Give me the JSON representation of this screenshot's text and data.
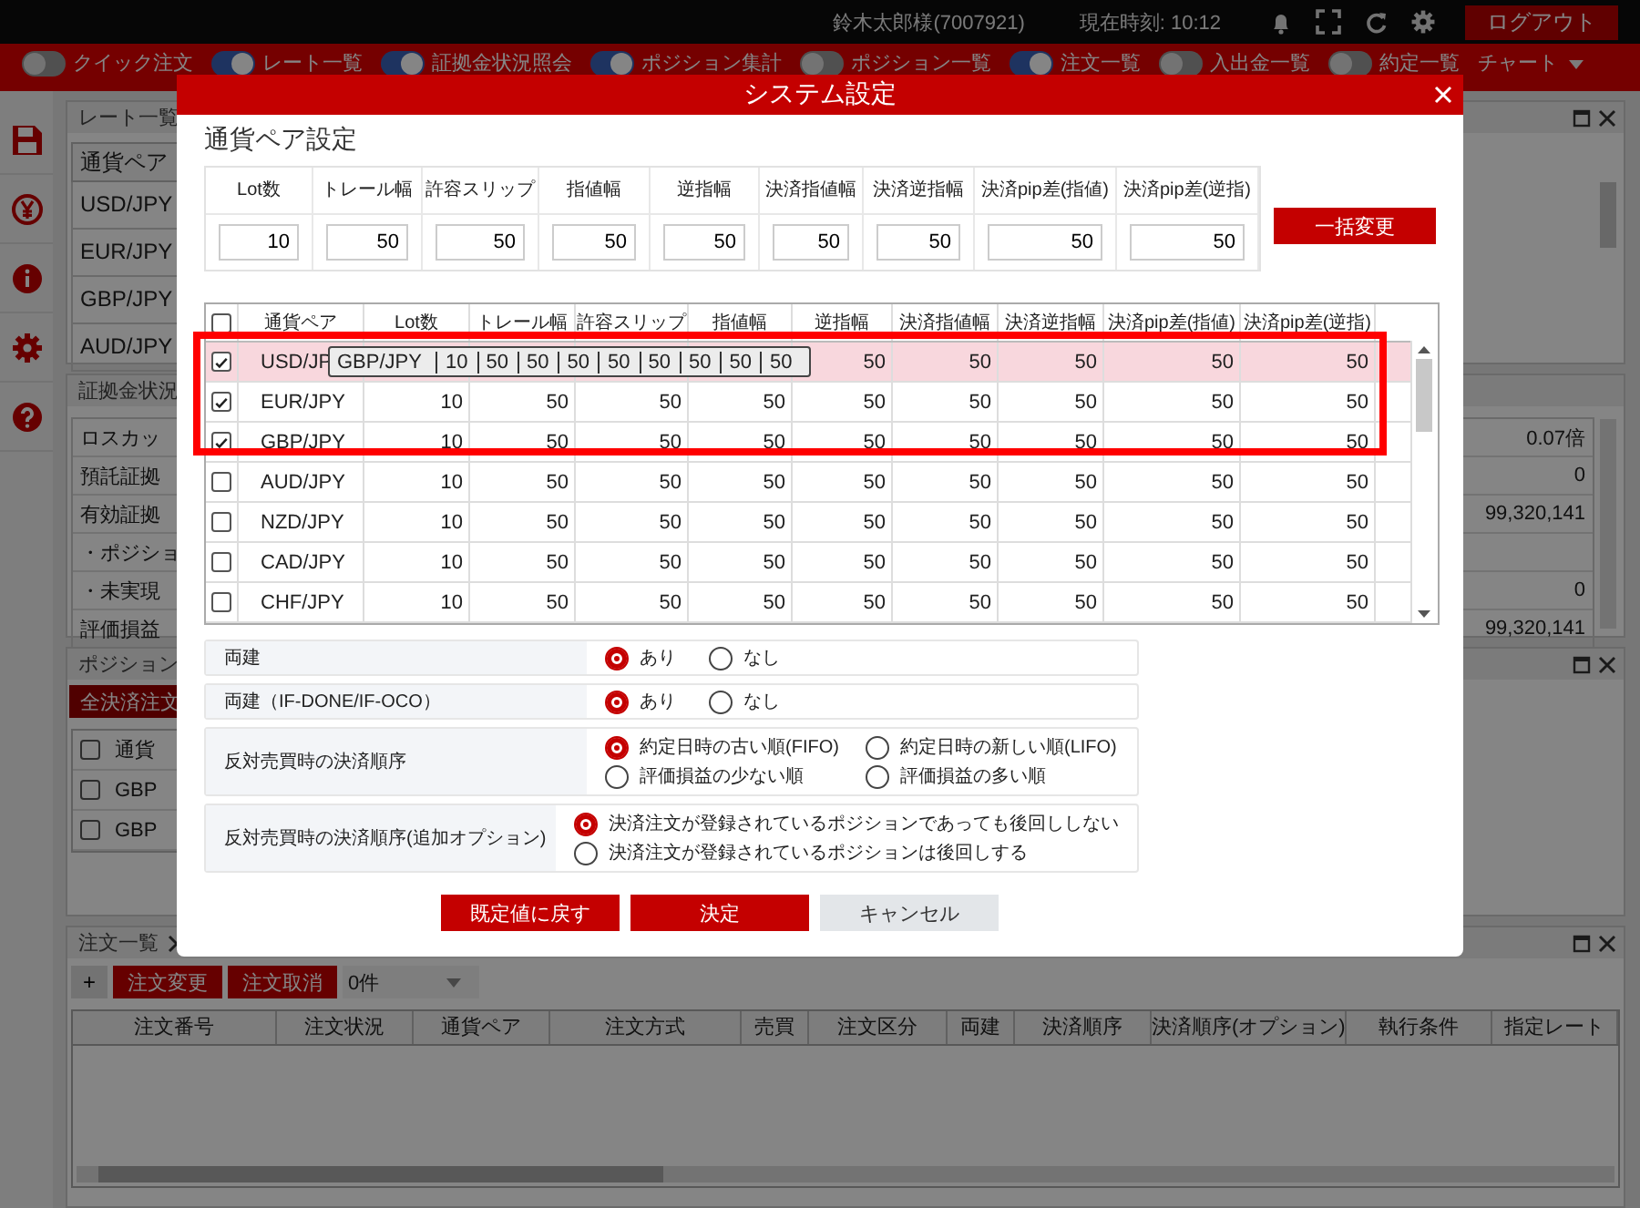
{
  "header": {
    "user": "鈴木太郎様(7007921)",
    "clock": "現在時刻: 10:12",
    "logout": "ログアウト"
  },
  "nav": [
    {
      "kind": "toggle",
      "label": "クイック注文",
      "on": false
    },
    {
      "kind": "toggle",
      "label": "レート一覧",
      "on": true
    },
    {
      "kind": "toggle",
      "label": "証拠金状況照会",
      "on": true
    },
    {
      "kind": "toggle",
      "label": "ポジション集計",
      "on": true
    },
    {
      "kind": "toggle",
      "label": "ポジション一覧",
      "on": false
    },
    {
      "kind": "toggle",
      "label": "注文一覧",
      "on": true
    },
    {
      "kind": "toggle",
      "label": "入出金一覧",
      "on": false
    },
    {
      "kind": "toggle",
      "label": "約定一覧",
      "on": false
    },
    {
      "kind": "menu",
      "label": "チャート"
    }
  ],
  "rate_panel": {
    "title": "レート一覧",
    "column": "通貨ペア",
    "rows": [
      "USD/JPY",
      "EUR/JPY",
      "GBP/JPY",
      "AUD/JPY"
    ]
  },
  "margin_panel": {
    "title": "証拠金状況",
    "rows": [
      {
        "label": "ロスカッ",
        "value": "0.07倍"
      },
      {
        "label": "預託証拠",
        "value": "0"
      },
      {
        "label": "有効証拠",
        "value": "99,320,141"
      },
      {
        "label": "・ポジショ"
      },
      {
        "label": "・未実現",
        "value": "0"
      },
      {
        "label": "評価損益",
        "value": "99,320,141"
      }
    ]
  },
  "position_panel": {
    "title": "ポジション",
    "button": "全決済注文",
    "header_checked": false,
    "column": "通貨",
    "rows": [
      {
        "pair": "GBP",
        "checked": false
      },
      {
        "pair": "GBP",
        "checked": false
      }
    ]
  },
  "order_panel": {
    "title": "注文一覧",
    "add": "+",
    "buttons": [
      "注文変更",
      "注文取消"
    ],
    "count": "0件",
    "columns": [
      "注文番号",
      "注文状況",
      "通貨ペア",
      "注文方式",
      "売買",
      "注文区分",
      "両建",
      "決済順序",
      "決済順序(オプション)",
      "執行条件",
      "指定レート"
    ]
  },
  "modal": {
    "title": "システム設定",
    "section": "通貨ペア設定",
    "batch": {
      "columns": [
        "Lot数",
        "トレール幅",
        "許容スリップ",
        "指値幅",
        "逆指幅",
        "決済指値幅",
        "決済逆指幅",
        "決済pip差(指値)",
        "決済pip差(逆指)"
      ],
      "values": [
        "10",
        "50",
        "50",
        "50",
        "50",
        "50",
        "50",
        "50",
        "50"
      ],
      "button": "一括変更"
    },
    "pairs": {
      "header_checked": false,
      "columns": [
        "通貨ペア",
        "Lot数",
        "トレール幅",
        "許容スリップ",
        "指値幅",
        "逆指幅",
        "決済指値幅",
        "決済逆指幅",
        "決済pip差(指値)",
        "決済pip差(逆指)"
      ],
      "rows": [
        {
          "checked": true,
          "selected": true,
          "cells": [
            "USD/JP",
            "",
            "",
            "",
            "",
            "50",
            "50",
            "50",
            "50",
            "50"
          ]
        },
        {
          "checked": true,
          "selected": false,
          "cells": [
            "EUR/JPY",
            "10",
            "50",
            "50",
            "50",
            "50",
            "50",
            "50",
            "50",
            "50"
          ]
        },
        {
          "checked": true,
          "selected": false,
          "cells": [
            "GBP/JPY",
            "10",
            "50",
            "50",
            "50",
            "50",
            "50",
            "50",
            "50",
            "50"
          ]
        },
        {
          "checked": false,
          "selected": false,
          "cells": [
            "AUD/JPY",
            "10",
            "50",
            "50",
            "50",
            "50",
            "50",
            "50",
            "50",
            "50"
          ]
        },
        {
          "checked": false,
          "selected": false,
          "cells": [
            "NZD/JPY",
            "10",
            "50",
            "50",
            "50",
            "50",
            "50",
            "50",
            "50",
            "50"
          ]
        },
        {
          "checked": false,
          "selected": false,
          "cells": [
            "CAD/JPY",
            "10",
            "50",
            "50",
            "50",
            "50",
            "50",
            "50",
            "50",
            "50"
          ]
        },
        {
          "checked": false,
          "selected": false,
          "cells": [
            "CHF/JPY",
            "10",
            "50",
            "50",
            "50",
            "50",
            "50",
            "50",
            "50",
            "50"
          ]
        }
      ]
    },
    "drag_preview": {
      "pair": "GBP/JPY",
      "values": [
        "10",
        "50",
        "50",
        "50",
        "50",
        "50",
        "50",
        "50",
        "50"
      ]
    },
    "annotation": {
      "kind": "frame"
    },
    "options": [
      {
        "label": "両建",
        "kind": "inline",
        "choices": [
          {
            "label": "あり",
            "selected": true
          },
          {
            "label": "なし",
            "selected": false
          }
        ]
      },
      {
        "label": "両建（IF-DONE/IF-OCO）",
        "kind": "inline",
        "choices": [
          {
            "label": "あり",
            "selected": true
          },
          {
            "label": "なし",
            "selected": false
          }
        ]
      },
      {
        "label": "反対売買時の決済順序",
        "kind": "grid",
        "choices": [
          {
            "label": "約定日時の古い順(FIFO)",
            "selected": true
          },
          {
            "label": "約定日時の新しい順(LIFO)",
            "selected": false
          },
          {
            "label": "評価損益の少ない順",
            "selected": false
          },
          {
            "label": "評価損益の多い順",
            "selected": false
          }
        ]
      },
      {
        "label": "反対売買時の決済順序(追加オプション)",
        "kind": "stack",
        "choices": [
          {
            "label": "決済注文が登録されているポジションであっても後回ししない",
            "selected": true
          },
          {
            "label": "決済注文が登録されているポジションは後回しする",
            "selected": false
          }
        ]
      }
    ],
    "buttons": [
      {
        "label": "既定値に戻す",
        "kind": "primary"
      },
      {
        "label": "決定",
        "kind": "primary"
      },
      {
        "label": "キャンセル",
        "kind": "secondary"
      }
    ]
  }
}
